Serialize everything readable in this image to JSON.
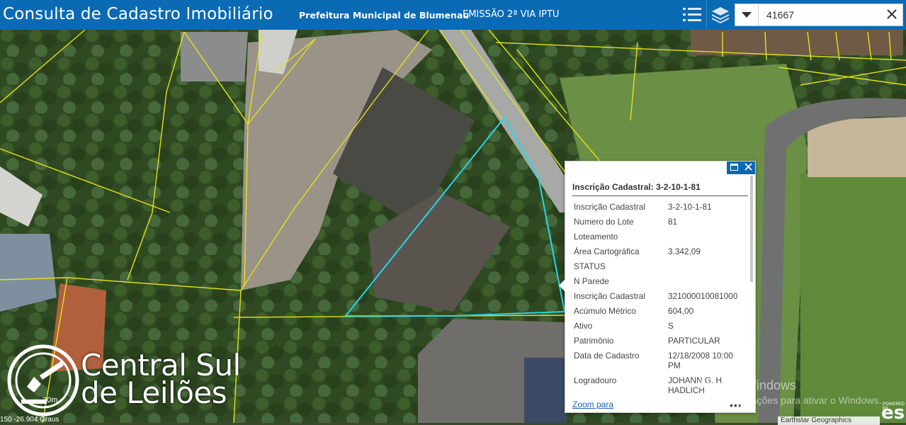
{
  "header": {
    "app_title": "Consulta de Cadastro Imobiliário",
    "nav_prefeitura": "Prefeitura Municipal de Blumenau",
    "nav_iptu": "EMISSÃO 2ª VIA IPTU",
    "list_icon": "list-icon",
    "layers_icon": "layers-icon"
  },
  "search": {
    "value": "41667",
    "dropdown_icon": "caret-down-icon",
    "clear_icon": "close-icon"
  },
  "popup": {
    "title": "Inscrição Cadastral: 3-2-10-1-81",
    "rows": [
      {
        "label": "Inscrição Cadastral",
        "value": "3-2-10-1-81"
      },
      {
        "label": "Numero do Lote",
        "value": "81"
      },
      {
        "label": "Loteamento",
        "value": ""
      },
      {
        "label": "Área Cartográfica",
        "value": "3.342,09"
      },
      {
        "label": "STATUS",
        "value": ""
      },
      {
        "label": "N Parede",
        "value": ""
      },
      {
        "label": "Inscrição Cadastral",
        "value": "321000010081000"
      },
      {
        "label": "Acúmulo Métrico",
        "value": "604,00"
      },
      {
        "label": "Ativo",
        "value": "S"
      },
      {
        "label": "Patrimônio",
        "value": "PARTICULAR"
      },
      {
        "label": "Data de Cadastro",
        "value": "12/18/2008 10:00 PM"
      },
      {
        "label": "Logradouro",
        "value": "JOHANN G. H. HADLICH"
      }
    ],
    "zoom_link": "Zoom para",
    "more": "•••"
  },
  "overlay": {
    "watermark_line1": "Ativar o Windows",
    "watermark_line2": "Acesse Configurações para ativar o Windows.",
    "attribution": "Earthstar Geographics",
    "esri": "esri",
    "esri_powered": "POWERED BY",
    "coordinates": "150 -26.904 Graus",
    "logo_line1": "Central Sul",
    "logo_line2": "de Leilões",
    "scale": "30m"
  },
  "colors": {
    "header_bg": "#0a6ab4",
    "parcel_lines": "#e6e01a",
    "selected_parcel": "#27d7e6"
  }
}
